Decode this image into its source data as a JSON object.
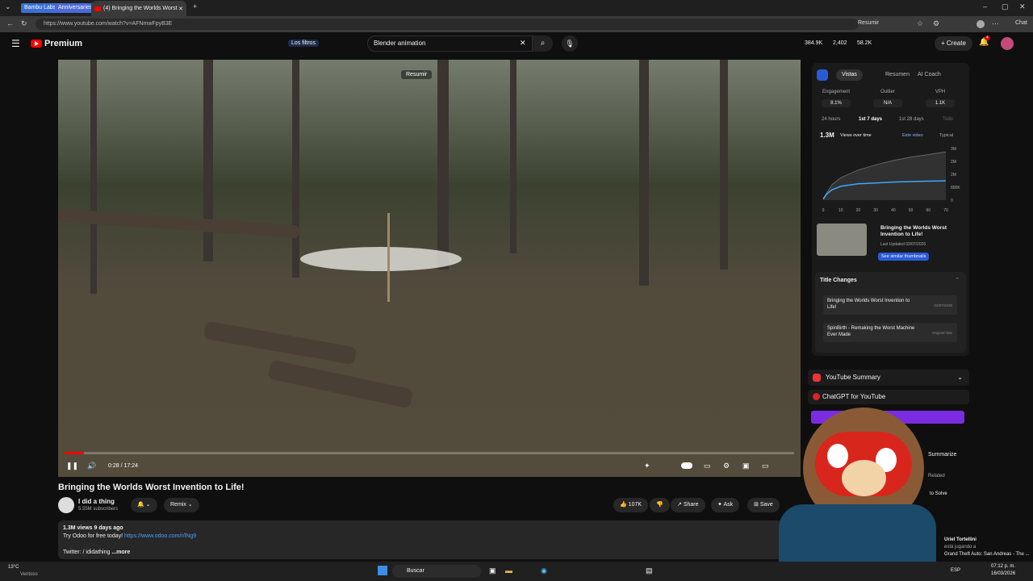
{
  "browser": {
    "tabs": [
      "Bambu Labs",
      "Anniversaries"
    ],
    "active_tab": "(4) Bringing the Worlds Worst",
    "url": "https://www.youtube.com/watch?v=AFNmwFpyB3E",
    "resumir": "Resumir",
    "chat": "Chat"
  },
  "header": {
    "logo": "Premium",
    "filters": "Los filtros",
    "search_value": "Blender animation",
    "stats": [
      "384.9K",
      "2,402",
      "58.2K"
    ],
    "create": "Create",
    "notifications": "4"
  },
  "video": {
    "resumir_overlay": "Resumir",
    "time": "0:28 / 17:24",
    "progress": 0.027
  },
  "info": {
    "title": "Bringing the Worlds Worst Invention to Life!",
    "channel": "I did a thing",
    "subscribers": "5.55M subscribers",
    "remix": "Remix",
    "likes": "107K",
    "share": "Share",
    "ask": "Ask",
    "save": "Save",
    "views_line": "1.3M views  9 days ago",
    "promo": "Try Odoo for free today!",
    "promo_link": "https://www.odoo.com/r/lNg9",
    "twitter": "Twitter:",
    "twitter_handle": "/ ididathing",
    "more": "...more"
  },
  "panel": {
    "tabs": [
      "Vistas",
      "Resumen",
      "AI Coach"
    ],
    "metrics": [
      {
        "label": "Engagement",
        "value": "8.1%"
      },
      {
        "label": "Outlier",
        "value": "N/A"
      },
      {
        "label": "VPH",
        "value": "1.1K"
      }
    ],
    "ranges": [
      "24 hours",
      "1st 7 days",
      "1st 28 days",
      "Todo"
    ],
    "total": "1.3M",
    "chart_mode": "Views over time",
    "legend": [
      "Este video",
      "Typical"
    ],
    "thumb_title": "Bringing the Worlds Worst Invention to Life!",
    "last_updated": "Last Updated 03/07/2026",
    "similar_btn": "See similar thumbnails",
    "title_changes_header": "Title Changes",
    "title_changes": [
      {
        "title": "Bringing the Worlds Worst Invention to Life!",
        "meta": "03/07/2026"
      },
      {
        "title": "SpinBirth - Remaking the Worst Machine Ever Made",
        "meta": "Original Title"
      }
    ]
  },
  "chart_data": {
    "type": "line",
    "x_ticks": [
      "0",
      "10",
      "20",
      "30",
      "40",
      "50",
      "60",
      "70"
    ],
    "y_ticks": [
      "3M",
      "2M",
      "2M",
      "800K",
      "0"
    ],
    "series": [
      {
        "name": "Este video",
        "x": [
          0,
          2,
          5,
          10,
          20,
          30,
          40,
          50,
          60,
          70
        ],
        "y": [
          0.05,
          0.35,
          0.6,
          0.8,
          0.95,
          1.0,
          1.05,
          1.08,
          1.1,
          1.12
        ]
      },
      {
        "name": "Typical",
        "x": [
          0,
          5,
          10,
          20,
          30,
          40,
          50,
          60,
          70
        ],
        "y": [
          0.1,
          0.9,
          1.3,
          1.75,
          2.05,
          2.3,
          2.5,
          2.65,
          2.8
        ]
      }
    ]
  },
  "extensions": {
    "youtube_summary": "YouTube Summary",
    "chatgpt": "ChatGPT for YouTube",
    "summarize": "Summarize",
    "related": "Related",
    "to_solve": "to Solve"
  },
  "stream": {
    "user": "Uriel Tortellini",
    "status": "está jugando a",
    "game": "Grand Theft Auto: San Andreas - The ..."
  },
  "taskbar": {
    "weather_temp": "13°C",
    "weather_desc": "Ventoso",
    "search": "Buscar",
    "lang": "ESP",
    "time": "07:12 p. m.",
    "date": "16/03/2026"
  }
}
